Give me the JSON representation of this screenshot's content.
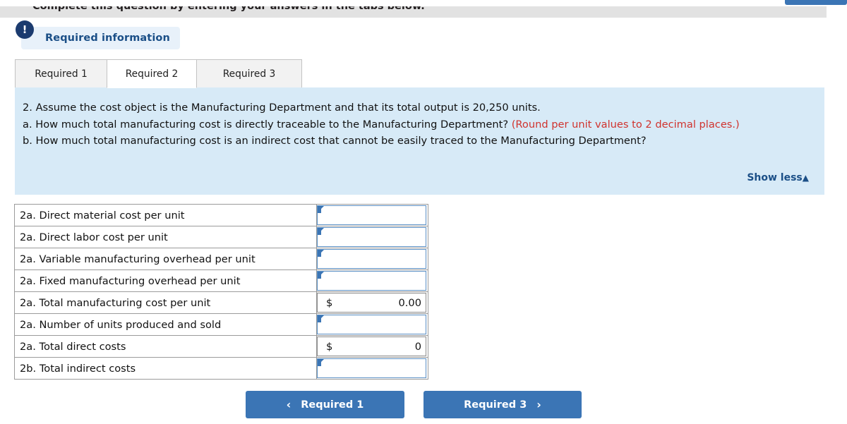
{
  "header": {
    "instruction": "Complete this question by entering your answers in the tabs below.",
    "top_right_button_label": ""
  },
  "alert": {
    "icon": "exclamation-icon",
    "icon_glyph": "!",
    "label": "Required information",
    "badge_color": "#1b3b6f",
    "pill_color": "#e8f1fa",
    "text_color": "#1b4f87"
  },
  "tabs": [
    {
      "label": "Required 1",
      "active": false
    },
    {
      "label": "Required 2",
      "active": true
    },
    {
      "label": "Required 3",
      "active": false
    }
  ],
  "question": {
    "background_color": "#d7eaf7",
    "line1": "2. Assume the cost object is the Manufacturing Department and that its total output is 20,250 units.",
    "line2a": "a. How much total manufacturing cost is directly traceable to the Manufacturing Department? ",
    "line2b_red": "(Round per unit values to 2 decimal places.)",
    "line3": "b. How much total manufacturing cost is an indirect cost that cannot be easily traced to the Manufacturing Department?",
    "show_less_label": "Show less",
    "show_less_caret": "▲"
  },
  "answer_table": {
    "rows": [
      {
        "label": "2a. Direct material cost per unit",
        "type": "input",
        "currency": "",
        "value": ""
      },
      {
        "label": "2a. Direct labor cost per unit",
        "type": "input",
        "currency": "",
        "value": ""
      },
      {
        "label": "2a. Variable manufacturing overhead per unit",
        "type": "input",
        "currency": "",
        "value": ""
      },
      {
        "label": "2a. Fixed manufacturing overhead per unit",
        "type": "input",
        "currency": "",
        "value": ""
      },
      {
        "label": "2a. Total manufacturing cost per unit",
        "type": "readonly",
        "currency": "$",
        "value": "0.00"
      },
      {
        "label": "2a. Number of units produced and sold",
        "type": "input",
        "currency": "",
        "value": ""
      },
      {
        "label": "2a. Total direct costs",
        "type": "readonly",
        "currency": "$",
        "value": "0"
      },
      {
        "label": "2b. Total indirect costs",
        "type": "input",
        "currency": "",
        "value": ""
      }
    ]
  },
  "navigation": {
    "prev_label": "Required 1",
    "prev_icon": "chevron-left-icon",
    "prev_glyph": "‹",
    "next_label": "Required 3",
    "next_icon": "chevron-right-icon",
    "next_glyph": "›",
    "button_color": "#3b75b5"
  }
}
